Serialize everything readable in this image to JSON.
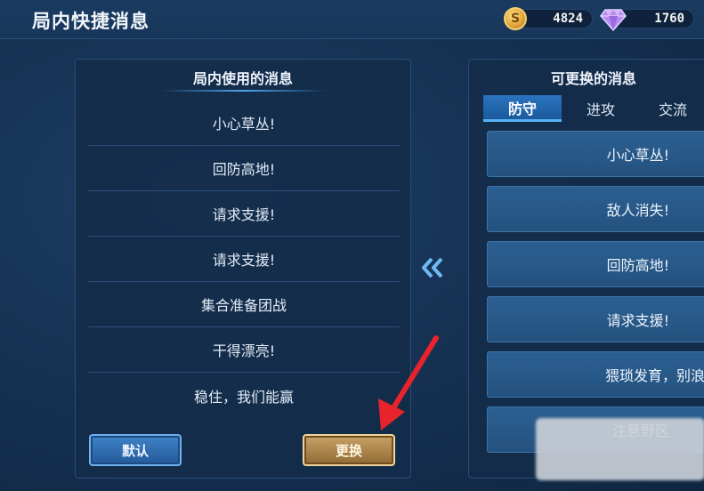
{
  "header": {
    "title": "局内快捷消息",
    "gold": "4824",
    "gems": "1760"
  },
  "left_panel": {
    "title": "局内使用的消息",
    "messages": [
      "小心草丛!",
      "回防高地!",
      "请求支援!",
      "请求支援!",
      "集合准备团战",
      "干得漂亮!",
      "稳住，我们能赢"
    ]
  },
  "buttons": {
    "default_label": "默认",
    "replace_label": "更换"
  },
  "right_panel": {
    "title": "可更换的消息",
    "tabs": [
      "防守",
      "进攻",
      "交流"
    ],
    "active_tab": "防守",
    "messages": [
      "小心草丛!",
      "敌人消失!",
      "回防高地!",
      "请求支援!",
      "猥琐发育，别浪",
      "注意野区"
    ]
  },
  "colors": {
    "accent_blue": "#2a74bf",
    "gold_button": "#c9a268",
    "arrow_red": "#e8232b"
  },
  "icons": {
    "gold": "coin-icon",
    "gems": "diamond-icon",
    "move": "double-chevron-left-icon"
  }
}
